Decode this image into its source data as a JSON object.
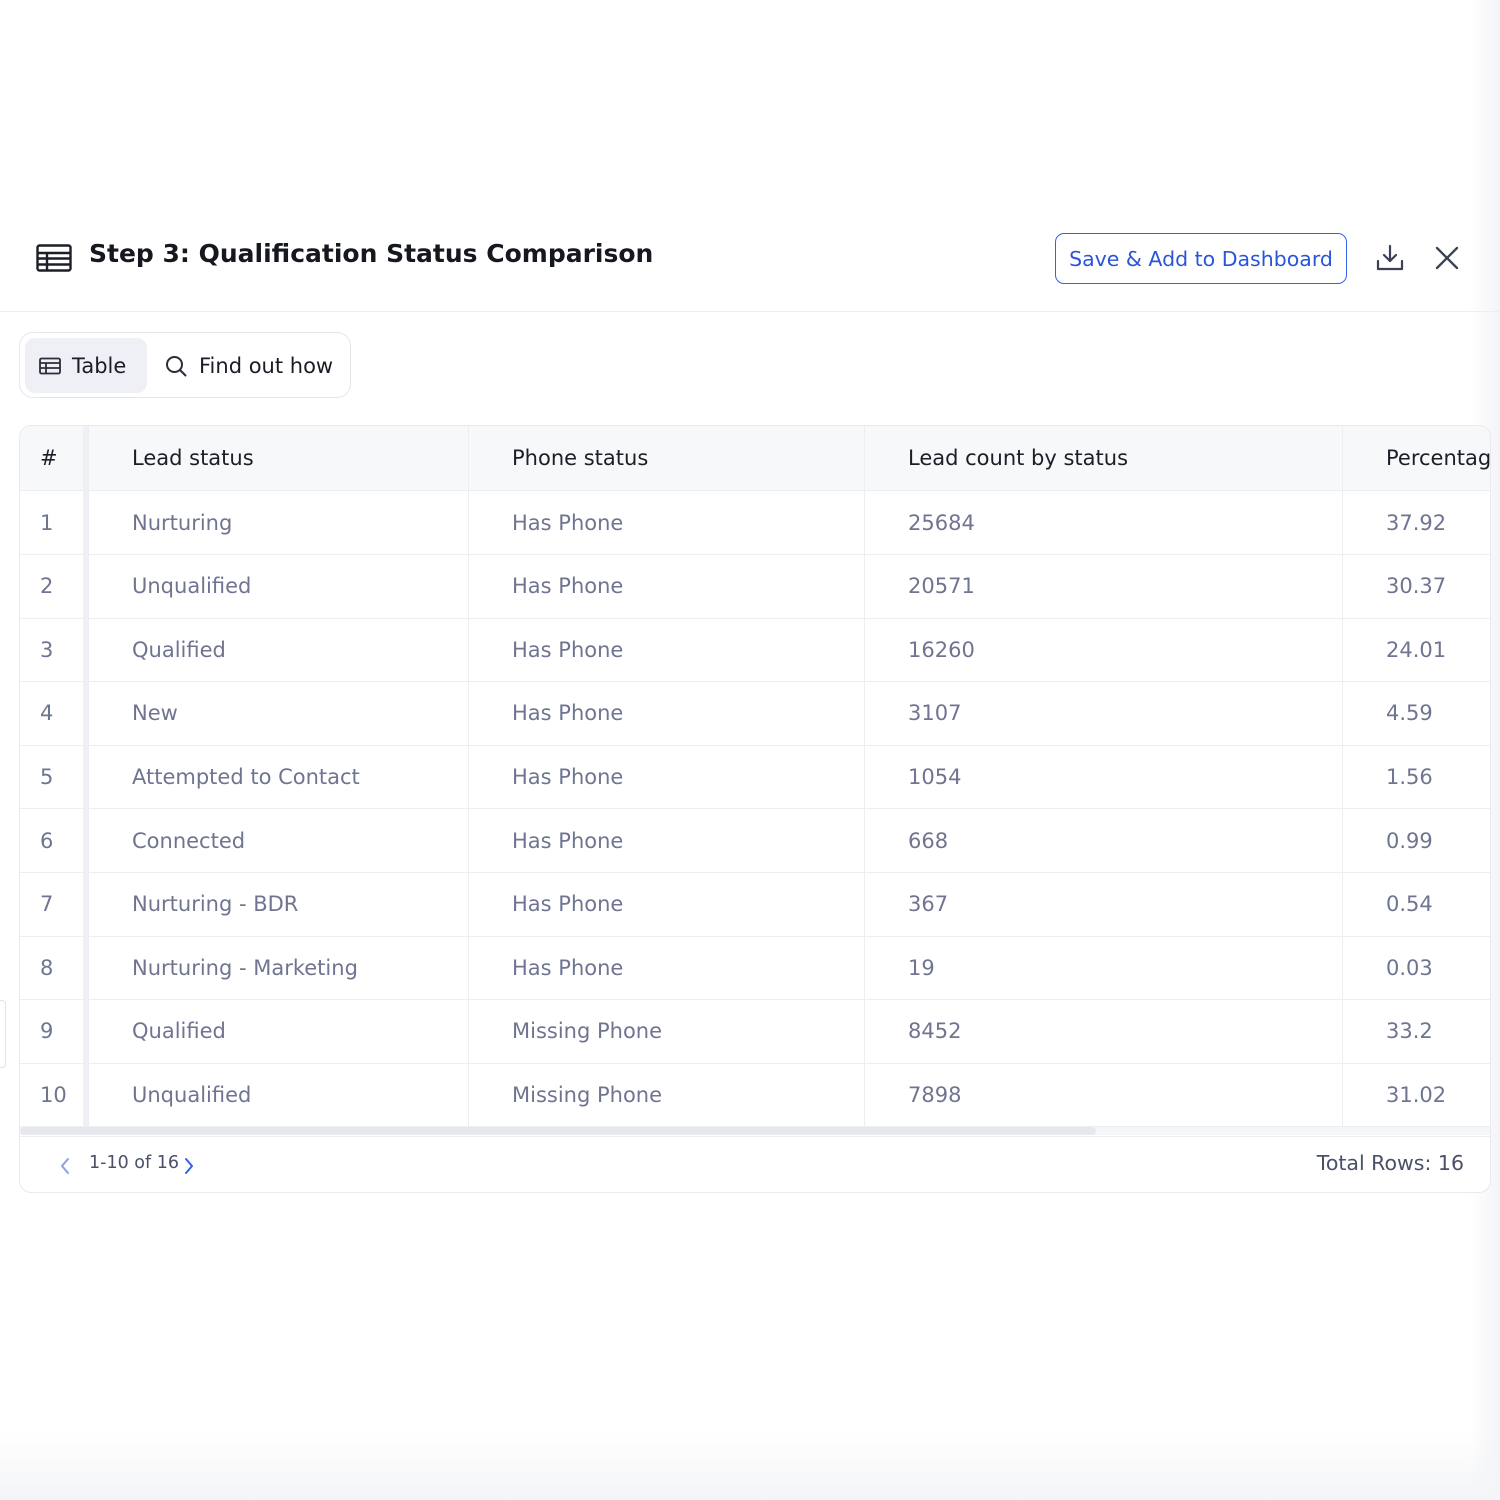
{
  "header": {
    "title": "Step 3: Qualification Status Comparison",
    "save_label": "Save & Add to Dashboard"
  },
  "view_toggle": {
    "table_label": "Table",
    "find_label": "Find out how"
  },
  "table": {
    "columns": [
      "#",
      "Lead status",
      "Phone status",
      "Lead count by status",
      "Percentag"
    ],
    "rows": [
      [
        "1",
        "Nurturing",
        "Has Phone",
        "25684",
        "37.92"
      ],
      [
        "2",
        "Unqualified",
        "Has Phone",
        "20571",
        "30.37"
      ],
      [
        "3",
        "Qualified",
        "Has Phone",
        "16260",
        "24.01"
      ],
      [
        "4",
        "New",
        "Has Phone",
        "3107",
        "4.59"
      ],
      [
        "5",
        "Attempted to Contact",
        "Has Phone",
        "1054",
        "1.56"
      ],
      [
        "6",
        "Connected",
        "Has Phone",
        "668",
        "0.99"
      ],
      [
        "7",
        "Nurturing - BDR",
        "Has Phone",
        "367",
        "0.54"
      ],
      [
        "8",
        "Nurturing - Marketing",
        "Has Phone",
        "19",
        "0.03"
      ],
      [
        "9",
        "Qualified",
        "Missing Phone",
        "8452",
        "33.2"
      ],
      [
        "10",
        "Unqualified",
        "Missing Phone",
        "7898",
        "31.02"
      ]
    ]
  },
  "pagination": {
    "range": "1-10 of 16",
    "total": "Total Rows: 16"
  },
  "colors": {
    "accent": "#3561e6",
    "text_muted": "#6f7590",
    "header_bg": "#f7f8fa"
  },
  "icons": {
    "title": "table-icon",
    "download": "download-icon",
    "close": "close-icon",
    "toggle_table": "table-icon",
    "toggle_find": "search-icon",
    "prev": "chevron-left-icon",
    "next": "chevron-right-icon"
  }
}
